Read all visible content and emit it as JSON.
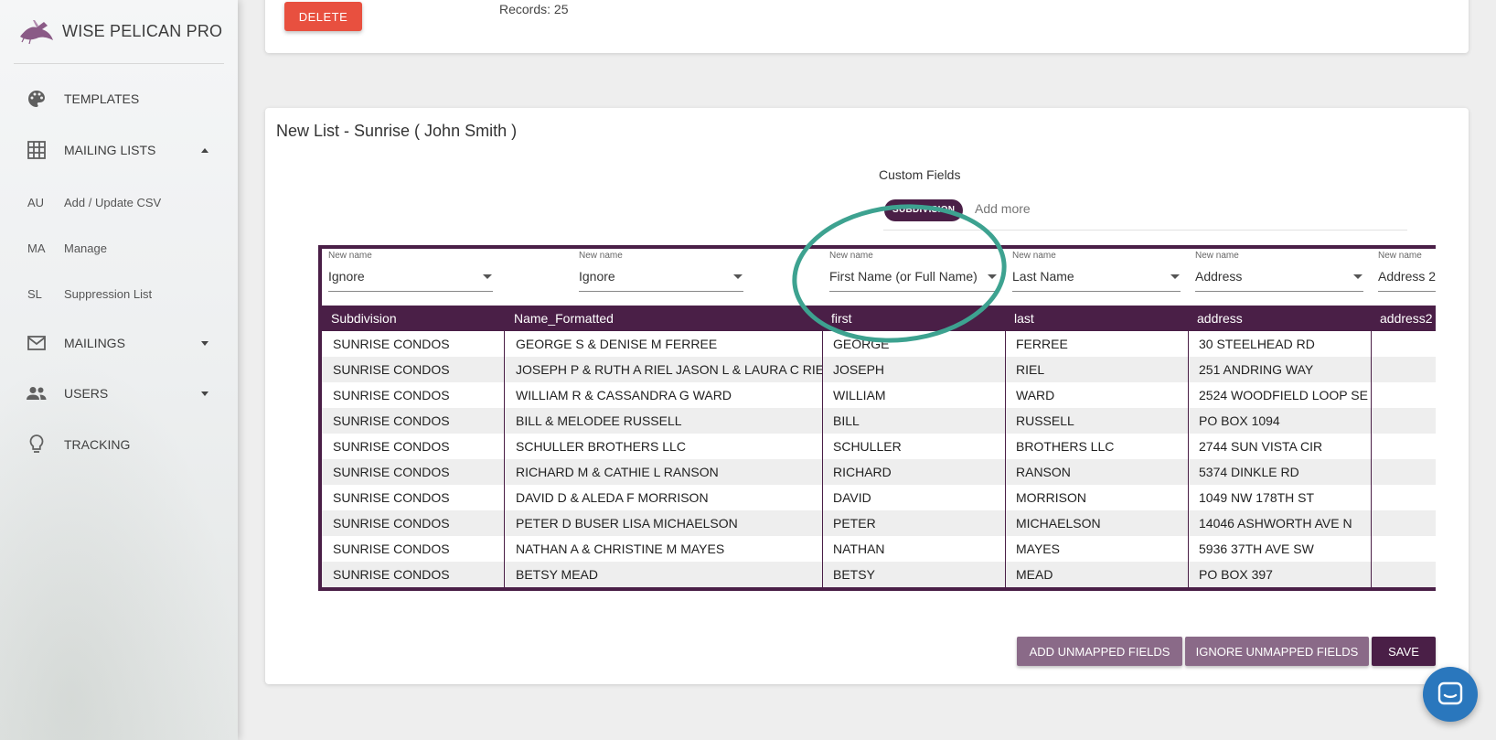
{
  "app": {
    "name": "WISE PELICAN PRO"
  },
  "sidebar": {
    "items": [
      {
        "label": "TEMPLATES",
        "icon": "palette-icon"
      },
      {
        "label": "MAILING LISTS",
        "icon": "grid-icon",
        "expanded": true
      },
      {
        "label": "MAILINGS",
        "icon": "mail-icon"
      },
      {
        "label": "USERS",
        "icon": "people-icon"
      },
      {
        "label": "TRACKING",
        "icon": "lightbulb-icon"
      }
    ],
    "subitems": [
      {
        "abbr": "AU",
        "label": "Add / Update CSV"
      },
      {
        "abbr": "MA",
        "label": "Manage"
      },
      {
        "abbr": "SL",
        "label": "Suppression List"
      }
    ]
  },
  "top_card": {
    "delete_label": "DELETE",
    "records": "Records: 25"
  },
  "main": {
    "title": "New List - Sunrise ( John Smith )",
    "custom_fields_label": "Custom Fields",
    "chip": "SUBDIVISION",
    "add_more_placeholder": "Add more"
  },
  "mapping": {
    "selector_small_label": "New name",
    "selectors": [
      "Ignore",
      "Ignore",
      "First Name (or Full Name)",
      "Last Name",
      "Address",
      "Address 2"
    ],
    "headers": [
      "Subdivision",
      "Name_Formatted",
      "first",
      "last",
      "address",
      "address2"
    ],
    "rows": [
      [
        "SUNRISE CONDOS",
        "GEORGE S & DENISE M FERREE",
        "GEORGE",
        "FERREE",
        "30 STEELHEAD RD",
        ""
      ],
      [
        "SUNRISE CONDOS",
        "JOSEPH P & RUTH A RIEL JASON L & LAURA C RIEL",
        "JOSEPH",
        "RIEL",
        "251 ANDRING WAY",
        ""
      ],
      [
        "SUNRISE CONDOS",
        "WILLIAM R & CASSANDRA G WARD",
        "WILLIAM",
        "WARD",
        "2524 WOODFIELD LOOP SE",
        ""
      ],
      [
        "SUNRISE CONDOS",
        "BILL & MELODEE RUSSELL",
        "BILL",
        "RUSSELL",
        "PO BOX 1094",
        ""
      ],
      [
        "SUNRISE CONDOS",
        "SCHULLER BROTHERS LLC",
        "SCHULLER",
        "BROTHERS LLC",
        "2744 SUN VISTA CIR",
        ""
      ],
      [
        "SUNRISE CONDOS",
        "RICHARD M & CATHIE L RANSON",
        "RICHARD",
        "RANSON",
        "5374 DINKLE RD",
        ""
      ],
      [
        "SUNRISE CONDOS",
        "DAVID D & ALEDA F MORRISON",
        "DAVID",
        "MORRISON",
        "1049 NW 178TH ST",
        ""
      ],
      [
        "SUNRISE CONDOS",
        "PETER D BUSER LISA MICHAELSON",
        "PETER",
        "MICHAELSON",
        "14046 ASHWORTH AVE N",
        ""
      ],
      [
        "SUNRISE CONDOS",
        "NATHAN A & CHRISTINE M MAYES",
        "NATHAN",
        "MAYES",
        "5936 37TH AVE SW",
        ""
      ],
      [
        "SUNRISE CONDOS",
        "BETSY MEAD",
        "BETSY",
        "MEAD",
        "PO BOX 397",
        ""
      ]
    ]
  },
  "actions": {
    "add_unmapped": "ADD UNMAPPED FIELDS",
    "ignore_unmapped": "IGNORE UNMAPPED FIELDS",
    "save": "SAVE"
  },
  "colors": {
    "brand": "#4a1f47",
    "delete": "#e8503f",
    "highlight_ring": "#3da290",
    "chat": "#2a77bd"
  }
}
